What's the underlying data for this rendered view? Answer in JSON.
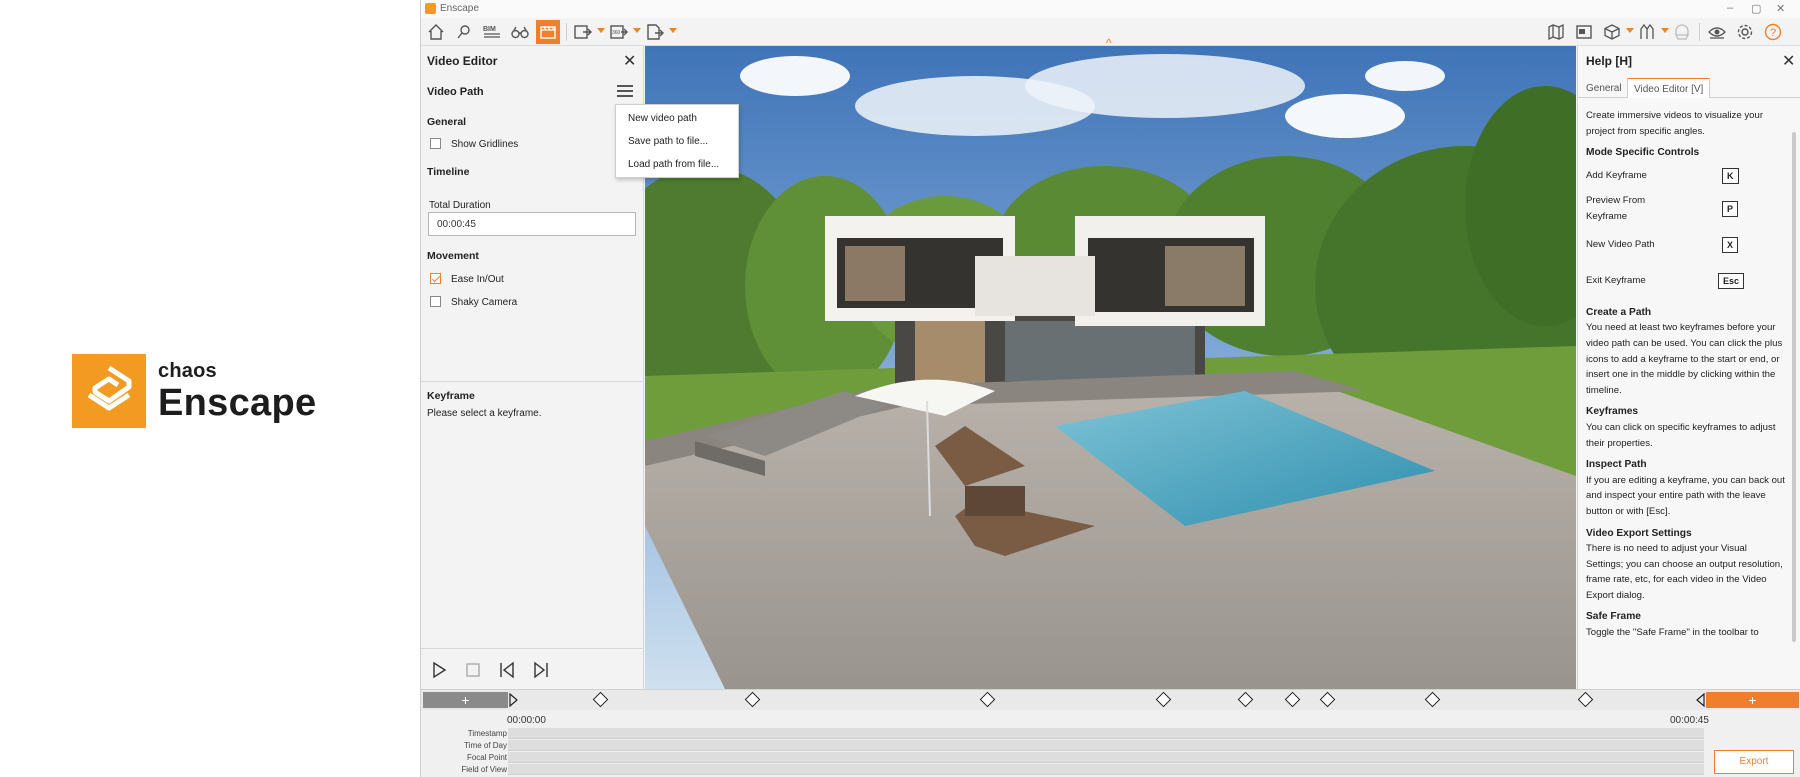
{
  "brand": {
    "top_word": "chaos",
    "name": "Enscape",
    "color": "#f39a22"
  },
  "window": {
    "title": "Enscape",
    "accent": "#f07f2d"
  },
  "toolbar": {
    "left_icons": [
      "home-icon",
      "pin-icon",
      "bim-icon",
      "binoculars-icon",
      "video-editor-icon",
      "screenshot-export-icon",
      "panorama-export-icon",
      "batch-export-icon"
    ],
    "right_icons": [
      "map-icon",
      "minimap-icon",
      "cube-icon",
      "asset-library-icon",
      "material-icon",
      "visibility-icon",
      "settings-icon",
      "help-icon"
    ],
    "bim_label": "BIM",
    "pano_label": "360"
  },
  "video_editor": {
    "title": "Video Editor",
    "path_heading": "Video Path",
    "general_heading": "General",
    "show_gridlines": {
      "label": "Show Gridlines",
      "checked": false
    },
    "timeline_heading": "Timeline",
    "total_duration_label": "Total Duration",
    "total_duration_value": "00:00:45",
    "movement_heading": "Movement",
    "ease_in_out": {
      "label": "Ease In/Out",
      "checked": true
    },
    "shaky_camera": {
      "label": "Shaky Camera",
      "checked": false
    },
    "keyframe_heading": "Keyframe",
    "keyframe_text": "Please select a keyframe."
  },
  "path_menu": {
    "items": [
      "New video path",
      "Save path to file...",
      "Load path from file..."
    ]
  },
  "help": {
    "title": "Help [H]",
    "tabs": [
      "General",
      "Video Editor [V]"
    ],
    "active_tab": "Video Editor [V]",
    "intro": "Create immersive videos to visualize your project from specific angles.",
    "controls_heading": "Mode Specific Controls",
    "controls": [
      {
        "label": "Add Keyframe",
        "key": "K"
      },
      {
        "label": "Preview From Keyframe",
        "key": "P"
      },
      {
        "label": "New Video Path",
        "key": "X"
      },
      {
        "label": "Exit Keyframe",
        "key": "Esc"
      }
    ],
    "sections": [
      {
        "heading": "Create a Path",
        "text": "You need at least two keyframes before your video path can be used. You can click the plus icons to add a keyframe to the start or end, or insert one in the middle by clicking within the timeline."
      },
      {
        "heading": "Keyframes",
        "text": "You can click on specific keyframes to adjust their properties."
      },
      {
        "heading": "Inspect Path",
        "text": "If you are editing a keyframe, you can back out and inspect your entire path with the leave button or with [Esc]."
      },
      {
        "heading": "Video Export Settings",
        "text": "There is no need to adjust your Visual Settings; you can choose an output resolution, frame rate, etc, for each video in the Video Export dialog."
      },
      {
        "heading": "Safe Frame",
        "text": "Toggle the \"Safe Frame\" in the toolbar to"
      }
    ]
  },
  "timeline": {
    "start_time": "00:00:00",
    "end_time": "00:00:45",
    "add_left": "+",
    "add_right": "+",
    "tracks": [
      "Timestamp",
      "Time of Day",
      "Focal Point",
      "Field of View"
    ],
    "keyframe_positions": [
      0.07,
      0.2,
      0.4,
      0.55,
      0.62,
      0.66,
      0.69,
      0.78,
      0.91
    ],
    "export_label": "Export"
  }
}
